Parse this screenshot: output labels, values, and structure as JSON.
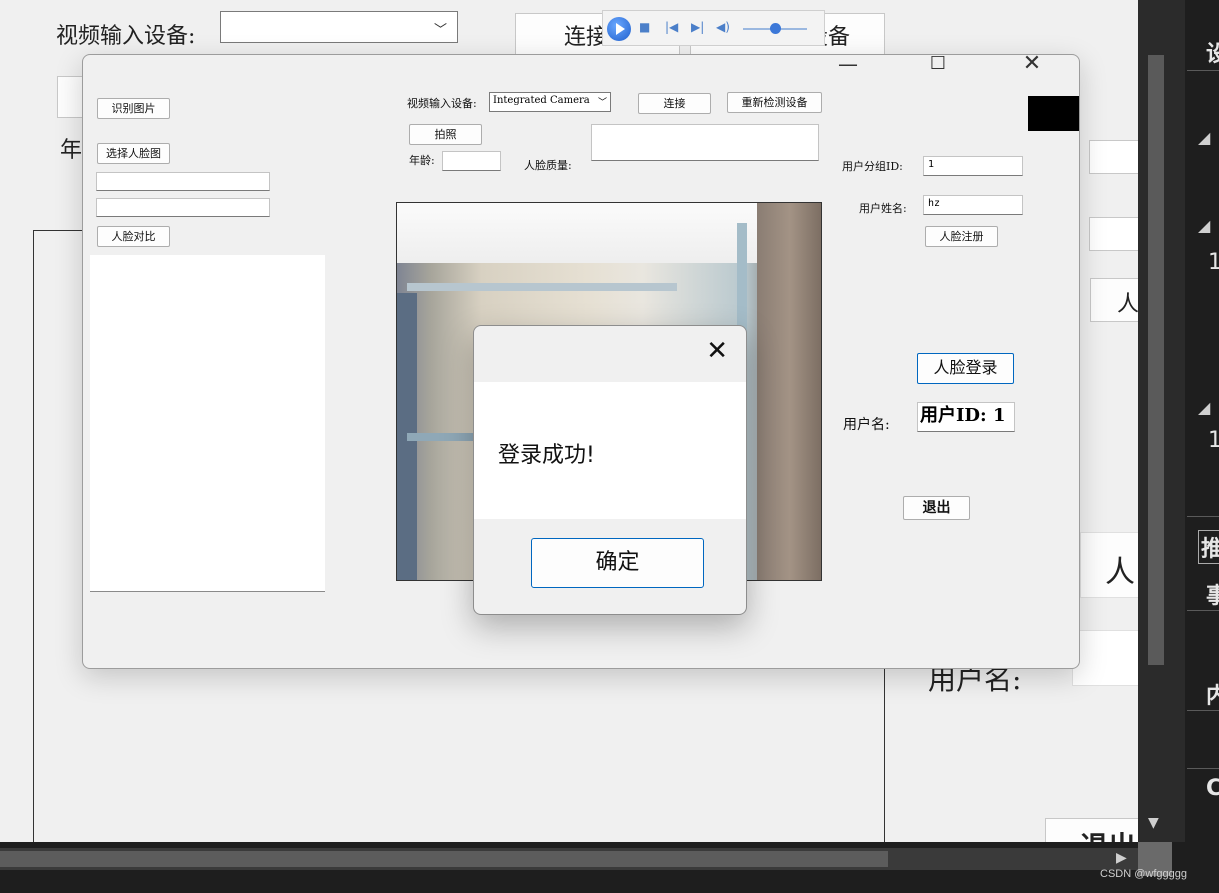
{
  "background": {
    "video_device_label": "视频输入设备:",
    "connect_partial": "连接",
    "device_partial": "设备",
    "age_partial": "年",
    "face_btn_partial": "人",
    "face_btn2_partial": "人",
    "username_label": "用户名:",
    "exit_partial": "退出"
  },
  "right_panel": {
    "items": [
      "设",
      "1",
      "1",
      "推",
      "事",
      "内",
      "C"
    ]
  },
  "watermark": "CSDN @wfggggg",
  "main_window": {
    "recognize_image_btn": "识别图片",
    "select_face_image_btn": "选择人脸图",
    "compare_faces_btn": "人脸对比",
    "video_device_label": "视频输入设备:",
    "video_device_value": "Integrated Camera",
    "connect_btn": "连接",
    "redetect_btn": "重新检测设备",
    "photo_btn": "拍照",
    "age_label": "年龄:",
    "face_quality_label": "人脸质量:",
    "group_id_label": "用户分组ID:",
    "group_id_value": "1",
    "user_name_label": "用户姓名:",
    "user_name_value": "hz",
    "register_btn": "人脸注册",
    "login_btn": "人脸登录",
    "username_label": "用户名:",
    "user_id_text": "用户ID: 1",
    "exit_btn": "退出"
  },
  "dialog": {
    "message": "登录成功!",
    "ok_btn": "确定"
  }
}
